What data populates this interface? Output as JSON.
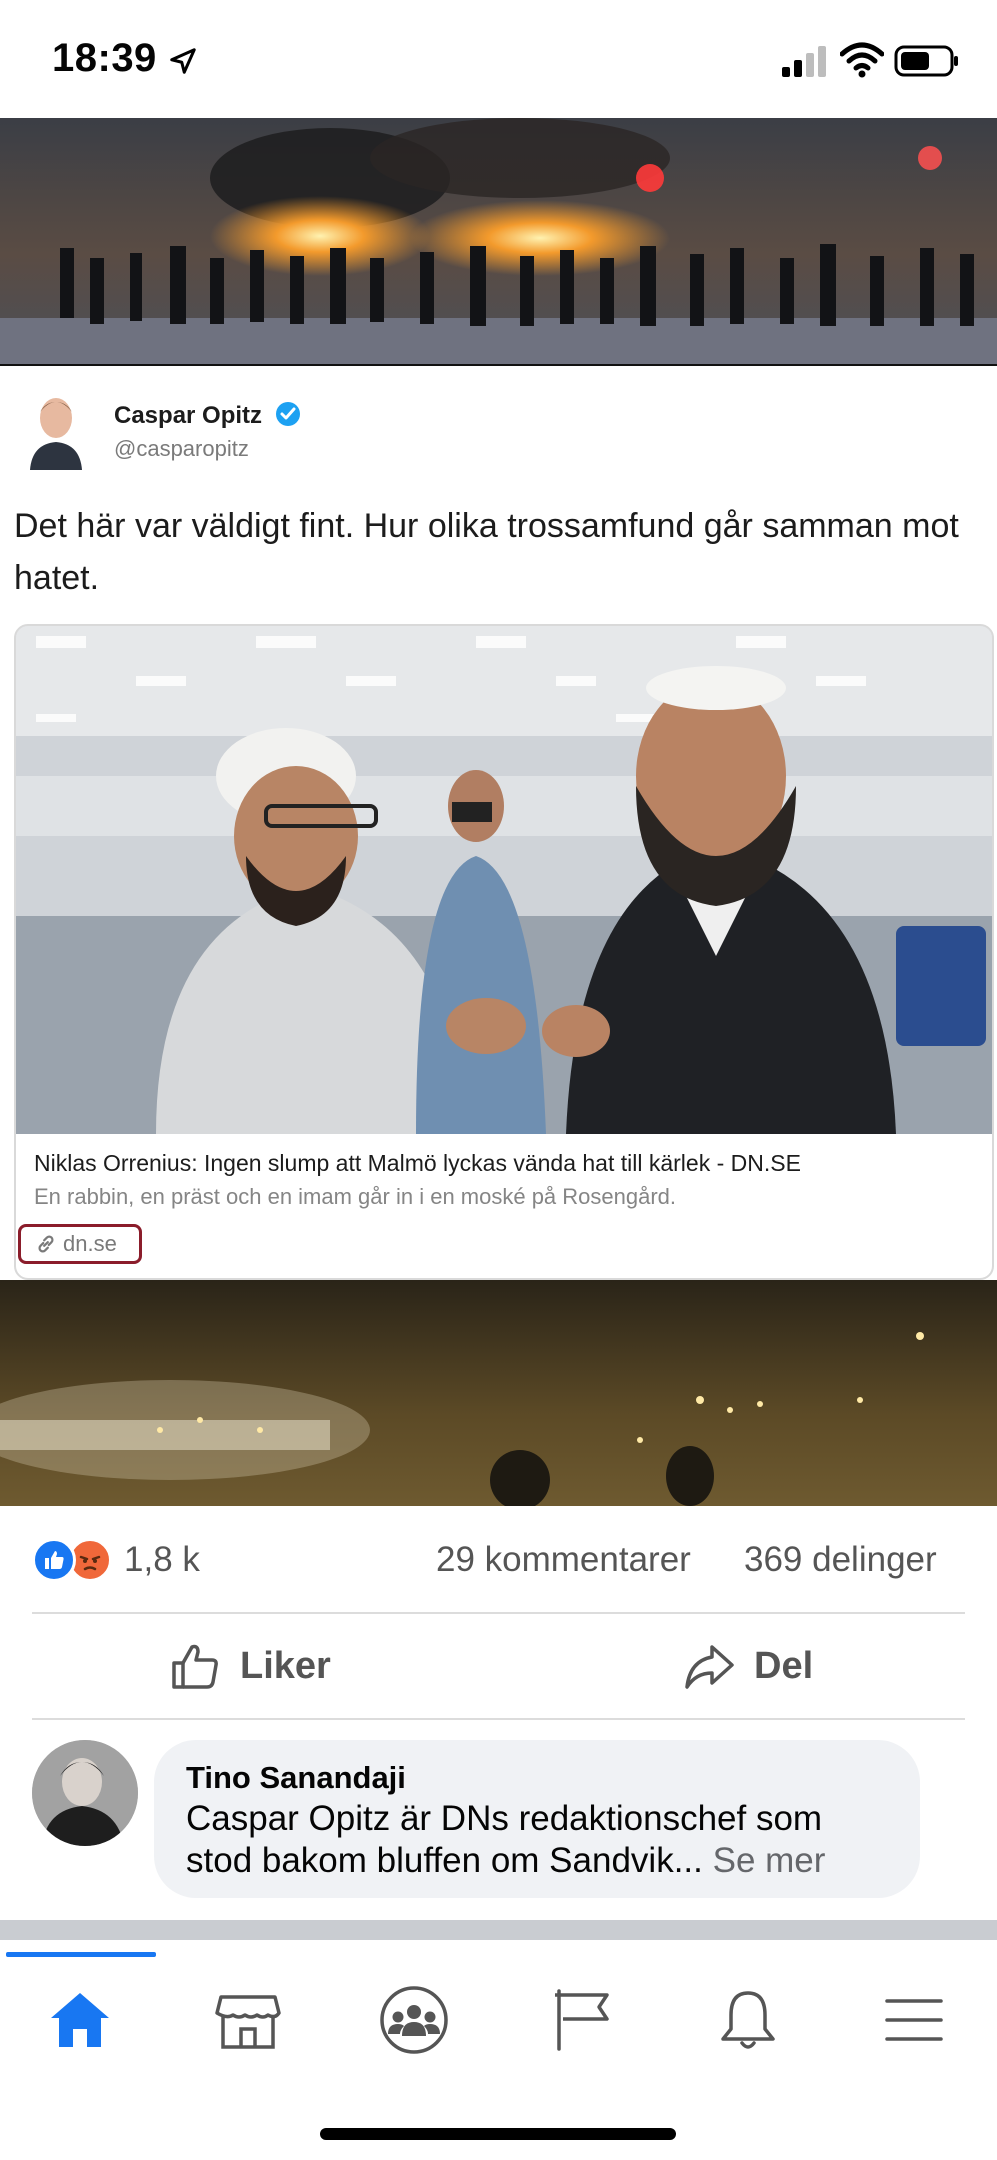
{
  "status_bar": {
    "time": "18:39"
  },
  "tweet": {
    "author_name": "Caspar Opitz",
    "author_handle": "@casparopitz",
    "text": "Det här var väldigt fint. Hur olika trossamfund går samman mot hatet.",
    "link_card": {
      "title": "Niklas Orrenius: Ingen slump att Malmö lyckas vända hat till kärlek - DN.SE",
      "description": "En rabbin, en präst och en imam går in i en moské på Rosengård.",
      "domain": "dn.se"
    }
  },
  "engagement": {
    "reaction_count": "1,8 k",
    "comments": "29 kommentarer",
    "shares": "369 delinger"
  },
  "actions": {
    "like_label": "Liker",
    "share_label": "Del"
  },
  "comment": {
    "author": "Tino Sanandaji",
    "text_line1": "Caspar Opitz är DNs redaktionschef som",
    "text_line2": "stod bakom bluffen om Sandvik...",
    "see_more": "Se mer"
  },
  "nav": {
    "items": [
      "home-icon",
      "marketplace-icon",
      "groups-icon",
      "pages-flag-icon",
      "notifications-bell-icon",
      "menu-icon"
    ],
    "active": "home-icon"
  },
  "colors": {
    "accent": "#1877f2",
    "angry": "#f0683a",
    "link_border": "#8b1d2b",
    "bubble": "#f0f2f5"
  }
}
